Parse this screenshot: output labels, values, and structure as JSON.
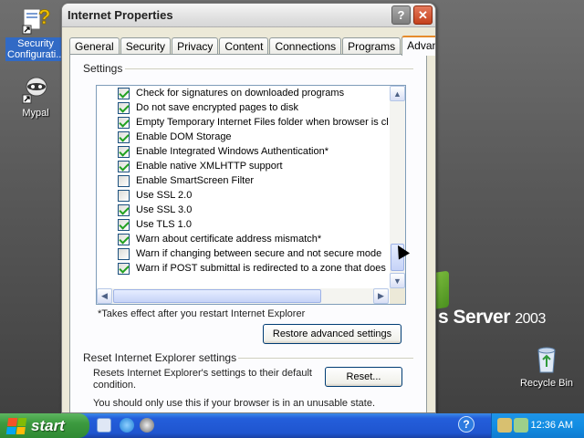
{
  "desktop": {
    "icons": [
      {
        "label": "Security\nConfigurati..."
      },
      {
        "label": "Mypal"
      },
      {
        "label": "Recycle Bin"
      }
    ],
    "brand_text": "s Server",
    "brand_version": "2003"
  },
  "window": {
    "title": "Internet Properties",
    "help_glyph": "?",
    "close_glyph": "✕",
    "tabs": [
      "General",
      "Security",
      "Privacy",
      "Content",
      "Connections",
      "Programs",
      "Advanced"
    ],
    "active_tab": "Advanced",
    "settings_group_label": "Settings",
    "settings_items": [
      {
        "label": "Check for signatures on downloaded programs",
        "checked": true
      },
      {
        "label": "Do not save encrypted pages to disk",
        "checked": true
      },
      {
        "label": "Empty Temporary Internet Files folder when browser is clo",
        "checked": true
      },
      {
        "label": "Enable DOM Storage",
        "checked": true
      },
      {
        "label": "Enable Integrated Windows Authentication*",
        "checked": true
      },
      {
        "label": "Enable native XMLHTTP support",
        "checked": true
      },
      {
        "label": "Enable SmartScreen Filter",
        "checked": false
      },
      {
        "label": "Use SSL 2.0",
        "checked": false
      },
      {
        "label": "Use SSL 3.0",
        "checked": true
      },
      {
        "label": "Use TLS 1.0",
        "checked": true
      },
      {
        "label": "Warn about certificate address mismatch*",
        "checked": true
      },
      {
        "label": "Warn if changing between secure and not secure mode",
        "checked": false
      },
      {
        "label": "Warn if POST submittal is redirected to a zone that does n",
        "checked": true
      }
    ],
    "restart_note": "*Takes effect after you restart Internet Explorer",
    "restore_button": "Restore advanced settings",
    "reset_group_label": "Reset Internet Explorer settings",
    "reset_description": "Resets Internet Explorer's settings to their default condition.",
    "reset_button": "Reset...",
    "reset_warning": "You should only use this if your browser is in an unusable state."
  },
  "taskbar": {
    "start_label": "start",
    "clock": "12:36 AM"
  }
}
